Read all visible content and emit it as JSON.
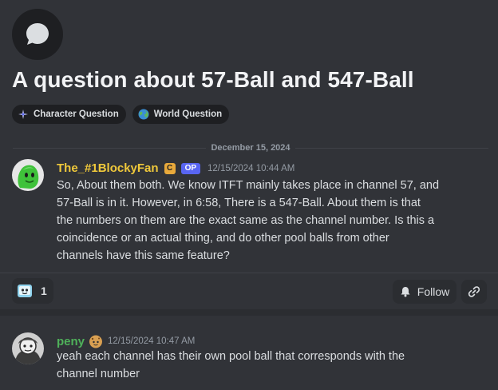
{
  "thread": {
    "icon": "chat-bubble-icon",
    "title": "A question about 57-Ball and 547-Ball",
    "tags": [
      {
        "label": "Character Question",
        "icon": "sparkle-icon"
      },
      {
        "label": "World Question",
        "icon": "globe-icon"
      }
    ],
    "date_divider": "December 15, 2024"
  },
  "original_post": {
    "username": "The_#1BlockyFan",
    "username_color": "#f0c93b",
    "badge": "C",
    "op_label": "OP",
    "timestamp": "12/15/2024 10:44 AM",
    "lines": [
      "So, About them both. We know ITFT mainly takes place in channel 57, and",
      "57-Ball is in it. However, in 6:58, There is a 547-Ball. About them is that",
      "the numbers on them are the exact same as the channel number. Is this a",
      "coincidence or an actual thing, and do other pool balls from other",
      "channels have this same feature?"
    ],
    "reaction": {
      "emoji": "robot-face-emoji",
      "count": "1"
    },
    "follow_label": "Follow",
    "link_icon": "link-icon"
  },
  "reply": {
    "username": "peny",
    "username_color": "#4fb15a",
    "emoji": "cookie-face-emoji",
    "timestamp": "12/15/2024 10:47 AM",
    "lines": [
      "yeah each channel has their own pool ball that corresponds with the",
      "channel number"
    ]
  },
  "colors": {
    "background": "#313338",
    "accent": "#5865f2"
  }
}
